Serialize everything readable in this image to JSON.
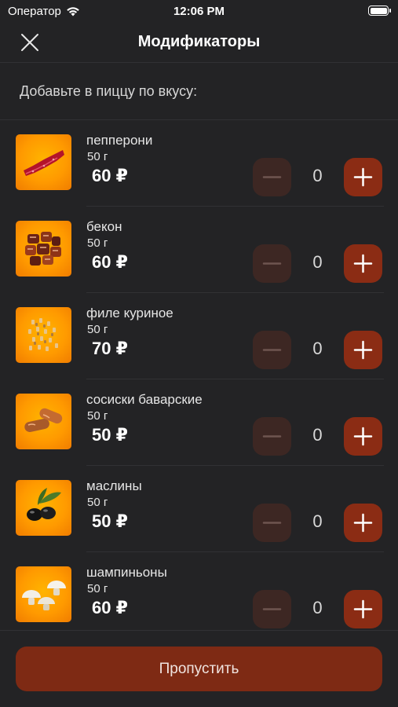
{
  "status_bar": {
    "carrier": "Оператор",
    "time": "12:06 PM"
  },
  "nav": {
    "title": "Модификаторы"
  },
  "subtitle": "Добавьте в пиццу по вкусу:",
  "items": [
    {
      "name": "пепперони",
      "weight": "50 г",
      "price": "60 ₽",
      "quantity": "0",
      "icon": "pepperoni-icon"
    },
    {
      "name": "бекон",
      "weight": "50 г",
      "price": "60 ₽",
      "quantity": "0",
      "icon": "bacon-icon"
    },
    {
      "name": "филе куриное",
      "weight": "50 г",
      "price": "70 ₽",
      "quantity": "0",
      "icon": "chicken-icon"
    },
    {
      "name": "сосиски баварские",
      "weight": "50 г",
      "price": "50 ₽",
      "quantity": "0",
      "icon": "sausages-icon"
    },
    {
      "name": "маслины",
      "weight": "50 г",
      "price": "50 ₽",
      "quantity": "0",
      "icon": "olives-icon"
    },
    {
      "name": "шампиньоны",
      "weight": "50 г",
      "price": "60 ₽",
      "quantity": "0",
      "icon": "mushrooms-icon"
    }
  ],
  "skip_label": "Пропустить",
  "colors": {
    "background": "#232325",
    "accent": "#8b2c14",
    "minus_button": "#3d2723",
    "thumb": "#ff9a00"
  }
}
